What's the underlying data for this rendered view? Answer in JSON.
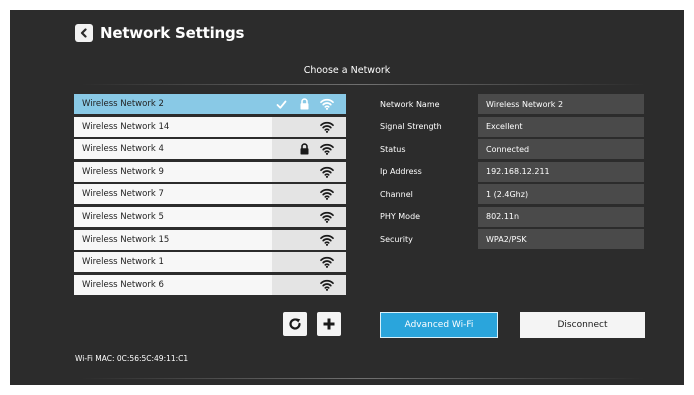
{
  "header": {
    "title": "Network Settings"
  },
  "section_title": "Choose a Network",
  "networks": [
    {
      "name": "Wireless Network 2",
      "selected": true,
      "verified": true,
      "locked": true
    },
    {
      "name": "Wireless Network 14",
      "selected": false,
      "verified": false,
      "locked": false
    },
    {
      "name": "Wireless Network 4",
      "selected": false,
      "verified": false,
      "locked": true
    },
    {
      "name": "Wireless Network 9",
      "selected": false,
      "verified": false,
      "locked": false
    },
    {
      "name": "Wireless Network 7",
      "selected": false,
      "verified": false,
      "locked": false
    },
    {
      "name": "Wireless Network 5",
      "selected": false,
      "verified": false,
      "locked": false
    },
    {
      "name": "Wireless Network 15",
      "selected": false,
      "verified": false,
      "locked": false
    },
    {
      "name": "Wireless Network 1",
      "selected": false,
      "verified": false,
      "locked": false
    },
    {
      "name": "Wireless Network 6",
      "selected": false,
      "verified": false,
      "locked": false
    }
  ],
  "details": [
    {
      "label": "Network Name",
      "value": "Wireless Network 2"
    },
    {
      "label": "Signal Strength",
      "value": "Excellent"
    },
    {
      "label": "Status",
      "value": "Connected"
    },
    {
      "label": "Ip Address",
      "value": "192.168.12.211"
    },
    {
      "label": "Channel",
      "value": "1 (2.4Ghz)"
    },
    {
      "label": "PHY Mode",
      "value": "802.11n"
    },
    {
      "label": "Security",
      "value": "WPA2/PSK"
    }
  ],
  "buttons": {
    "advanced": "Advanced Wi-Fi",
    "disconnect": "Disconnect"
  },
  "mac": "Wi-Fi MAC: 0C:56:5C:49:11:C1",
  "icons": {
    "back": "back-arrow-icon",
    "refresh": "refresh-icon",
    "add": "plus-icon",
    "signal": "wifi-icon",
    "lock": "lock-icon",
    "check": "check-icon"
  },
  "colors": {
    "background": "#2c2c2c",
    "accent": "#2aa5dc",
    "selected_row": "#89c9e6",
    "detail_value_bg": "#4a4a4a"
  }
}
